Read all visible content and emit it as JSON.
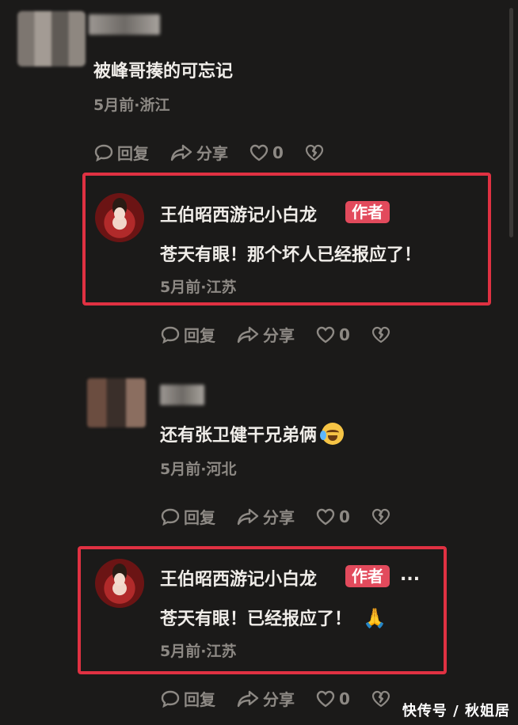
{
  "actions": {
    "reply": "回复",
    "share": "分享"
  },
  "comments": [
    {
      "text": "被峰哥揍的可忘记",
      "meta": "5月前·浙江",
      "likes": "0"
    },
    {
      "name": "王伯昭西游记小白龙",
      "badge": "作者",
      "text": "苍天有眼！那个坏人已经报应了！",
      "meta": "5月前·江苏",
      "likes": "0"
    },
    {
      "text": "还有张卫健干兄弟俩",
      "meta": "5月前·河北",
      "likes": "0"
    },
    {
      "name": "王伯昭西游记小白龙",
      "badge": "作者",
      "ellipsis": "...",
      "text": "苍天有眼！已经报应了！",
      "meta": "5月前·江苏",
      "likes": "0"
    }
  ],
  "watermark": "快传号 / 秋姐居",
  "colors": {
    "background": "#1b1a19",
    "highlight": "#e03142",
    "badge": "#e24a5c",
    "meta": "#8d8984"
  }
}
